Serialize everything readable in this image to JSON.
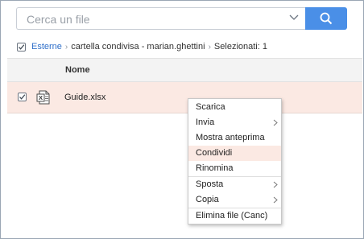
{
  "search": {
    "placeholder": "Cerca un file"
  },
  "breadcrumb": {
    "root": "Esterne",
    "folder": "cartella condivisa - marian.ghettini",
    "selection": "Selezionati: 1"
  },
  "table": {
    "columns": [
      "Nome"
    ],
    "rows": [
      {
        "name": "Guide.xlsx",
        "checked": true,
        "icon": "excel-file-icon"
      }
    ]
  },
  "context_menu": {
    "items": [
      {
        "label": "Scarica",
        "submenu": false
      },
      {
        "label": "Invia",
        "submenu": true
      },
      {
        "label": "Mostra anteprima",
        "submenu": false
      },
      {
        "label": "Condividi",
        "submenu": false,
        "highlighted": true
      },
      {
        "label": "Rinomina",
        "submenu": false
      },
      {
        "label": "Sposta",
        "submenu": true
      },
      {
        "label": "Copia",
        "submenu": true
      },
      {
        "label": "Elimina file (Canc)",
        "submenu": false
      }
    ]
  },
  "colors": {
    "accent": "#4a8fe7",
    "link": "#2f6fc9",
    "selected_row": "#fbe9e3"
  }
}
